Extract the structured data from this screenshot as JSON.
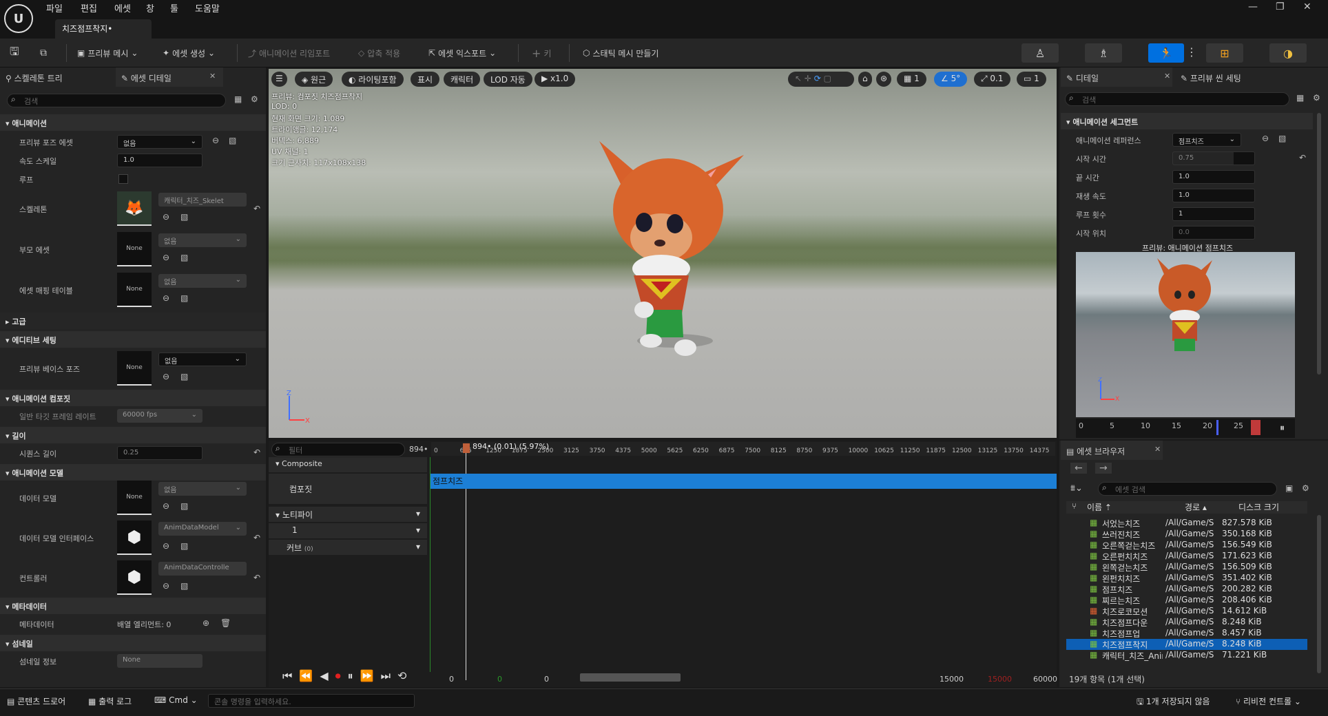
{
  "menubar": {
    "logo": "U",
    "items": [
      "파일",
      "편집",
      "에셋",
      "창",
      "툴",
      "도움말"
    ],
    "tab_title": "치즈점프착지•"
  },
  "toolbar": {
    "preview_mesh": "프리뷰 메시",
    "create_asset": "에셋 생성",
    "reimport": "애니메이션 리임포트",
    "compress": "압축 적용",
    "export_asset": "에셋 익스포트",
    "key": "키",
    "static_mesh": "스태틱 메시 만들기"
  },
  "left_panel": {
    "tab_skeleton": "스켈레톤 트리",
    "tab_details": "에셋 디테일",
    "search_placeholder": "검색",
    "sections": {
      "animation": "애니메이션",
      "advanced": "고급",
      "editor_settings": "에디티브 세팅",
      "anim_composite": "애니메이션 컴포짓",
      "length": "길이",
      "anim_model": "애니메이션 모델",
      "metadata": "메타데이터",
      "thumbnail": "섬네일"
    },
    "props": {
      "preview_pose": "프리뷰 포즈 에셋",
      "preview_pose_val": "없음",
      "rate_scale": "속도 스케일",
      "rate_scale_val": "1.0",
      "loop": "루프",
      "skeleton": "스켈레톤",
      "skeleton_val": "캐릭터_치즈_Skelet",
      "parent_asset": "부모 에셋",
      "parent_asset_val": "없음",
      "asset_mapping": "에셋 매핑 테이블",
      "asset_mapping_val": "없음",
      "preview_base_pose": "프리뷰 베이스 포즈",
      "preview_base_pose_val": "없음",
      "target_frame_rate": "일반 타깃 프레임 레이트",
      "target_frame_rate_val": "60000 fps",
      "seq_length": "시퀀스 길이",
      "seq_length_val": "0.25",
      "data_model": "데이터 모델",
      "data_model_val": "없음",
      "data_model_iface": "데이터 모델 인터페이스",
      "data_model_iface_val": "AnimDataModel",
      "controller": "컨트롤러",
      "controller_val": "AnimDataControlle",
      "metadata": "메타데이터",
      "metadata_val": "배열 엘리먼트: 0",
      "thumb_info": "섬네일 정보",
      "thumb_info_val": "None",
      "none": "None"
    }
  },
  "viewport": {
    "perspective": "원근",
    "lighting": "라이팅포함",
    "show": "표시",
    "character": "캐릭터",
    "lod": "LOD 자동",
    "speed": "x1.0",
    "grid_val": "1",
    "angle_val": "5°",
    "scale_val": "0.1",
    "cam_val": "1",
    "stats": [
      "프리뷰: 컴포짓 치즈점프착지",
      "LOD: 0",
      "현재 화면 크기: 1.089",
      "트라이앵글: 12,174",
      "버텍스: 6,889",
      "UV 채널: 1",
      "크기 근사치: 117x108x138"
    ]
  },
  "sequencer": {
    "filter_placeholder": "필터",
    "frame": "894•",
    "playhead_label": "894• (0.01) (5.97%)",
    "composite": "Composite",
    "composite_track": "컴포짓",
    "clip_label": "점프치즈",
    "notify": "노티파이",
    "notify_num": "1",
    "curves": "커브",
    "curves_count": "(0)",
    "ticks": [
      "0",
      "625",
      "1250",
      "1875",
      "2500",
      "3125",
      "3750",
      "4375",
      "5000",
      "5625",
      "6250",
      "6875",
      "7500",
      "8125",
      "8750",
      "9375",
      "10000",
      "10625",
      "11250",
      "11875",
      "12500",
      "13125",
      "13750",
      "14375"
    ],
    "range_start": "0",
    "range_start_green": "0",
    "range_view_start": "0",
    "range_end_view": "15000",
    "range_end_red": "15000",
    "range_max": "60000"
  },
  "detail_panel": {
    "tab_details": "디테일",
    "tab_preview_scene": "프리뷰 씬 세팅",
    "search_placeholder": "검색",
    "section": "애니메이션 세그먼트",
    "anim_ref": "애니메이션 레퍼런스",
    "anim_ref_val": "점프치즈",
    "start_time": "시작 시간",
    "start_time_val": "0.75",
    "end_time": "끝 시간",
    "end_time_val": "1.0",
    "play_rate": "재생 속도",
    "play_rate_val": "1.0",
    "loop_count": "루프 횟수",
    "loop_count_val": "1",
    "start_pos": "시작 위치",
    "start_pos_val": "0.0",
    "preview_title": "프리뷰: 애니메이션 점프치즈",
    "preview_ticks": [
      "0",
      "5",
      "10",
      "15",
      "20",
      "25"
    ]
  },
  "asset_browser": {
    "tab": "에셋 브라우저",
    "search_placeholder": "에셋 검색",
    "col_name": "이름",
    "col_path": "경로",
    "col_size": "디스크 크기",
    "rows": [
      {
        "name": "서었는치즈",
        "path": "/All/Game/S",
        "size": "827.578 KiB"
      },
      {
        "name": "쓰러진치즈",
        "path": "/All/Game/S",
        "size": "350.168 KiB"
      },
      {
        "name": "오른쪽걷는치즈",
        "path": "/All/Game/S",
        "size": "156.549 KiB"
      },
      {
        "name": "오른펀치치즈",
        "path": "/All/Game/S",
        "size": "171.623 KiB"
      },
      {
        "name": "왼쪽걷는치즈",
        "path": "/All/Game/S",
        "size": "156.509 KiB"
      },
      {
        "name": "왼펀치치즈",
        "path": "/All/Game/S",
        "size": "351.402 KiB"
      },
      {
        "name": "점프치즈",
        "path": "/All/Game/S",
        "size": "200.282 KiB"
      },
      {
        "name": "찌르는치즈",
        "path": "/All/Game/S",
        "size": "208.406 KiB"
      },
      {
        "name": "치즈로코모션",
        "path": "/All/Game/S",
        "size": "14.612 KiB"
      },
      {
        "name": "치즈점프다운",
        "path": "/All/Game/S",
        "size": "8.248 KiB"
      },
      {
        "name": "치즈점프업",
        "path": "/All/Game/S",
        "size": "8.457 KiB"
      },
      {
        "name": "치즈점프착지",
        "path": "/All/Game/S",
        "size": "8.248 KiB"
      },
      {
        "name": "캐릭터_치즈_Anim_mi:",
        "path": "/All/Game/S",
        "size": "71.221 KiB"
      }
    ],
    "count": "19개 항목 (1개 선택)"
  },
  "statusbar": {
    "content_drawer": "콘텐츠 드로어",
    "output_log": "출력 로그",
    "cmd": "Cmd",
    "console_placeholder": "콘솔 명령을 입력하세요.",
    "unsaved": "1개 저장되지 않음",
    "revision": "리비전 컨트롤"
  }
}
